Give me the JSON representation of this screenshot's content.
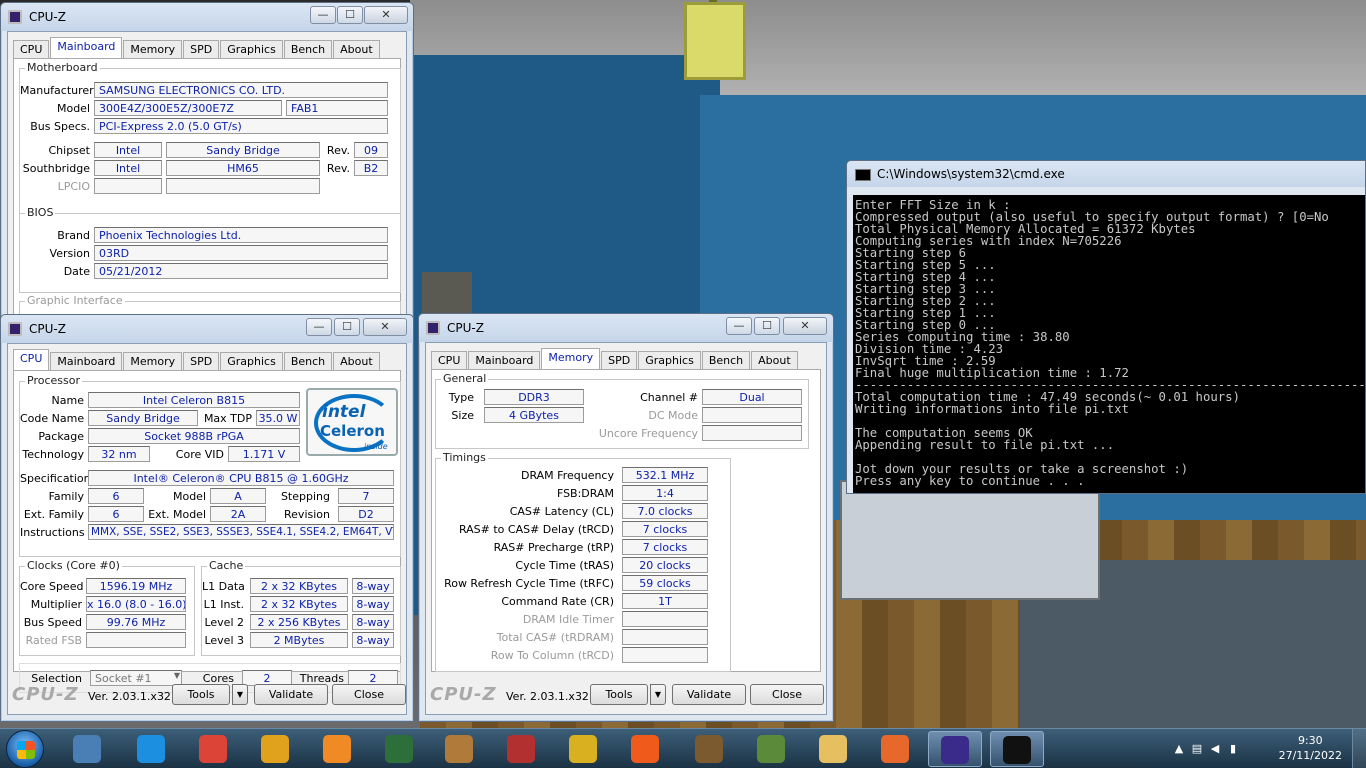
{
  "common": {
    "app_title": "CPU-Z",
    "tabs": [
      "CPU",
      "Mainboard",
      "Memory",
      "SPD",
      "Graphics",
      "Bench",
      "About"
    ],
    "logo": "CPU-Z",
    "version": "Ver. 2.03.1.x32",
    "tools": "Tools",
    "validate": "Validate",
    "close": "Close"
  },
  "mainboard": {
    "active_tab": "Mainboard",
    "motherboard_title": "Motherboard",
    "manufacturer_label": "Manufacturer",
    "manufacturer": "SAMSUNG ELECTRONICS CO. LTD.",
    "model_label": "Model",
    "model": "300E4Z/300E5Z/300E7Z",
    "model_rev": "FAB1",
    "busspecs_label": "Bus Specs.",
    "busspecs": "PCI-Express 2.0 (5.0 GT/s)",
    "chipset_label": "Chipset",
    "chipset_vendor": "Intel",
    "chipset_name": "Sandy Bridge",
    "chipset_rev_label": "Rev.",
    "chipset_rev": "09",
    "southbridge_label": "Southbridge",
    "sb_vendor": "Intel",
    "sb_name": "HM65",
    "sb_rev_label": "Rev.",
    "sb_rev": "B2",
    "lpcio_label": "LPCIO",
    "bios_title": "BIOS",
    "brand_label": "Brand",
    "brand": "Phoenix Technologies Ltd.",
    "version_label": "Version",
    "version": "03RD",
    "date_label": "Date",
    "date": "05/21/2012",
    "graphic_title": "Graphic Interface"
  },
  "cpu": {
    "active_tab": "CPU",
    "processor_title": "Processor",
    "name_label": "Name",
    "name": "Intel Celeron B815",
    "codename_label": "Code Name",
    "codename": "Sandy Bridge",
    "maxtdp_label": "Max TDP",
    "maxtdp": "35.0 W",
    "package_label": "Package",
    "package": "Socket 988B rPGA",
    "tech_label": "Technology",
    "tech": "32 nm",
    "corevid_label": "Core VID",
    "corevid": "1.171 V",
    "spec_label": "Specification",
    "spec": "Intel® Celeron® CPU B815 @ 1.60GHz",
    "family_label": "Family",
    "family": "6",
    "model_label": "Model",
    "model": "A",
    "stepping_label": "Stepping",
    "stepping": "7",
    "extfamily_label": "Ext. Family",
    "extfamily": "6",
    "extmodel_label": "Ext. Model",
    "extmodel": "2A",
    "revision_label": "Revision",
    "revision": "D2",
    "instr_label": "Instructions",
    "instr": "MMX, SSE, SSE2, SSE3, SSSE3, SSE4.1, SSE4.2, EM64T, VT-x",
    "clocks_title": "Clocks (Core #0)",
    "corespeed_label": "Core Speed",
    "corespeed": "1596.19 MHz",
    "mult_label": "Multiplier",
    "mult": "x 16.0 (8.0 - 16.0)",
    "busspeed_label": "Bus Speed",
    "busspeed": "99.76 MHz",
    "ratedfsb_label": "Rated FSB",
    "cache_title": "Cache",
    "l1d_label": "L1 Data",
    "l1d": "2 x 32 KBytes",
    "l1d_way": "8-way",
    "l1i_label": "L1 Inst.",
    "l1i": "2 x 32 KBytes",
    "l1i_way": "8-way",
    "l2_label": "Level 2",
    "l2": "2 x 256 KBytes",
    "l2_way": "8-way",
    "l3_label": "Level 3",
    "l3": "2 MBytes",
    "l3_way": "8-way",
    "selection_label": "Selection",
    "selection": "Socket #1",
    "cores_label": "Cores",
    "cores": "2",
    "threads_label": "Threads",
    "threads": "2",
    "intel_logo": {
      "brand": "intel",
      "product": "Celeron",
      "tag": "inside"
    }
  },
  "memory": {
    "active_tab": "Memory",
    "general_title": "General",
    "type_label": "Type",
    "type": "DDR3",
    "size_label": "Size",
    "size": "4 GBytes",
    "channel_label": "Channel #",
    "channel": "Dual",
    "dcmode_label": "DC Mode",
    "uncore_label": "Uncore Frequency",
    "timings_title": "Timings",
    "timings": [
      {
        "label": "DRAM Frequency",
        "value": "532.1 MHz",
        "dim": false
      },
      {
        "label": "FSB:DRAM",
        "value": "1:4",
        "dim": false
      },
      {
        "label": "CAS# Latency (CL)",
        "value": "7.0 clocks",
        "dim": false
      },
      {
        "label": "RAS# to CAS# Delay (tRCD)",
        "value": "7 clocks",
        "dim": false
      },
      {
        "label": "RAS# Precharge (tRP)",
        "value": "7 clocks",
        "dim": false
      },
      {
        "label": "Cycle Time (tRAS)",
        "value": "20 clocks",
        "dim": false
      },
      {
        "label": "Row Refresh Cycle Time (tRFC)",
        "value": "59 clocks",
        "dim": false
      },
      {
        "label": "Command Rate (CR)",
        "value": "1T",
        "dim": false
      },
      {
        "label": "DRAM Idle Timer",
        "value": "",
        "dim": true
      },
      {
        "label": "Total CAS# (tRDRAM)",
        "value": "",
        "dim": true
      },
      {
        "label": "Row To Column (tRCD)",
        "value": "",
        "dim": true
      }
    ]
  },
  "cmd": {
    "title": "C:\\Windows\\system32\\cmd.exe",
    "lines": [
      "Enter FFT Size in k :",
      "Compressed output (also useful to specify output format) ? [0=No",
      "Total Physical Memory Allocated = 61372 Kbytes",
      "Computing series with index N=705226",
      "Starting step 6",
      "Starting step 5 ...",
      "Starting step 4 ...",
      "Starting step 3 ...",
      "Starting step 2 ...",
      "Starting step 1 ...",
      "Starting step 0 ...",
      "Series computing time : 38.80",
      "Division time : 4.23",
      "InvSqrt time : 2.59",
      "Final huge multiplication time : 1.72",
      "-------------------------------------------------------------------------------",
      "Total computation time : 47.49 seconds(~ 0.01 hours)",
      "Writing informations into file pi.txt",
      "",
      "The computation seems OK",
      "Appending result to file pi.txt ...",
      "",
      "Jot down your results or take a screenshot :)",
      "Press any key to continue . . ."
    ]
  },
  "taskbar": {
    "apps": [
      {
        "name": "control-panel",
        "color": "#4a7fb5"
      },
      {
        "name": "internet-explorer",
        "color": "#1c8fe0"
      },
      {
        "name": "chrome",
        "color": "#db4437"
      },
      {
        "name": "keepass",
        "color": "#e0a21c"
      },
      {
        "name": "video-player",
        "color": "#f08a24"
      },
      {
        "name": "hwmonitor",
        "color": "#2c6f3a"
      },
      {
        "name": "shovel",
        "color": "#b07a3b"
      },
      {
        "name": "stick-figure",
        "color": "#b23030"
      },
      {
        "name": "tool",
        "color": "#d8b020"
      },
      {
        "name": "kamikaze",
        "color": "#f05a1a"
      },
      {
        "name": "minecraft-launcher",
        "color": "#7a5a2e"
      },
      {
        "name": "minecraft",
        "color": "#5a8a3a"
      },
      {
        "name": "explorer",
        "color": "#e6c060"
      },
      {
        "name": "firefox",
        "color": "#e8672a"
      },
      {
        "name": "cpu-z",
        "color": "#3a2a8a"
      },
      {
        "name": "cmd",
        "color": "#111111"
      }
    ],
    "time": "9:30",
    "date": "27/11/2022"
  }
}
